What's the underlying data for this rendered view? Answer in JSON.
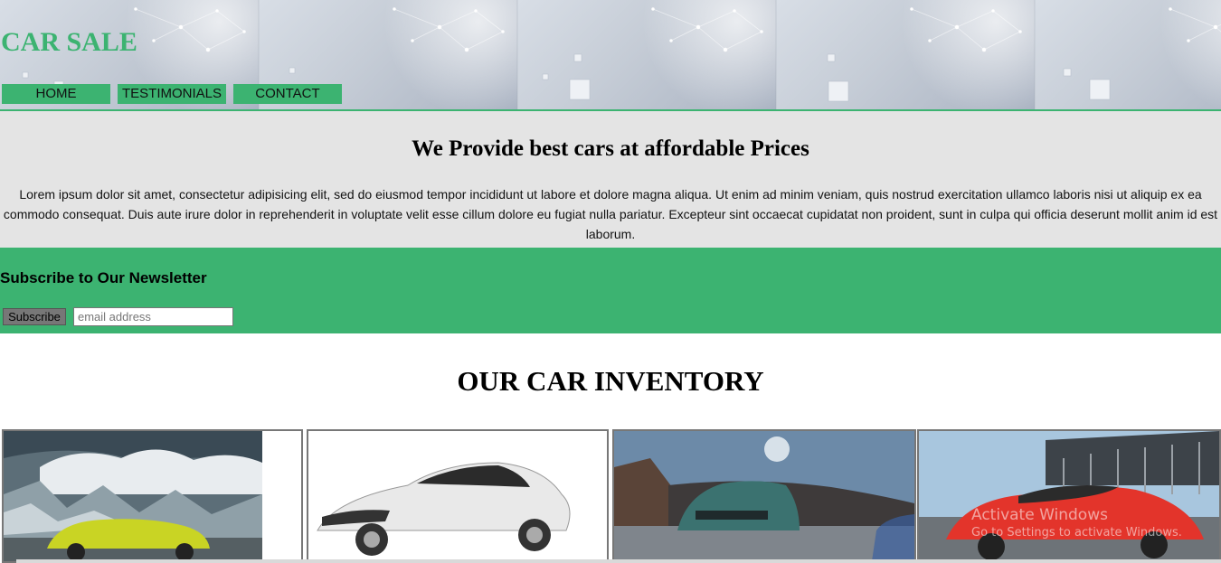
{
  "header": {
    "brand": "CAR SALE",
    "nav": [
      "HOME",
      "TESTIMONIALS",
      "CONTACT"
    ]
  },
  "intro": {
    "heading": "We Provide best cars at affordable Prices",
    "body": "Lorem ipsum dolor sit amet, consectetur adipisicing elit, sed do eiusmod tempor incididunt ut labore et dolore magna aliqua. Ut enim ad minim veniam, quis nostrud exercitation ullamco laboris nisi ut aliquip ex ea commodo consequat. Duis aute irure dolor in reprehenderit in voluptate velit esse cillum dolore eu fugiat nulla pariatur. Excepteur sint occaecat cupidatat non proident, sunt in culpa qui officia deserunt mollit anim id est laborum."
  },
  "newsletter": {
    "heading": "Subscribe to Our Newsletter",
    "button_label": "Subscribe",
    "email_placeholder": "email address"
  },
  "inventory": {
    "heading": "OUR CAR INVENTORY"
  },
  "watermark": {
    "line1": "Activate Windows",
    "line2": "Go to Settings to activate Windows."
  },
  "colors": {
    "accent": "#3cb371",
    "intro_bg": "#e4e4e4"
  }
}
